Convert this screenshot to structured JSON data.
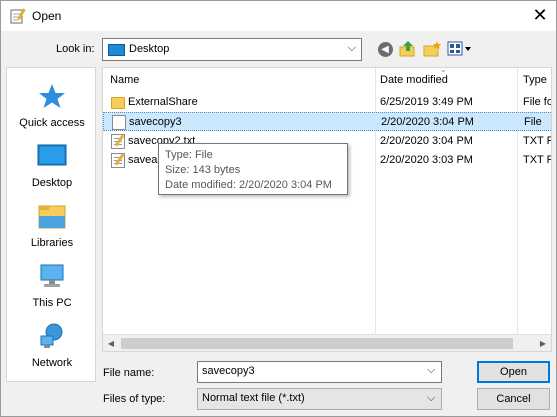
{
  "window": {
    "title": "Open",
    "close_label": "✕"
  },
  "lookin": {
    "label": "Look in:",
    "value": "Desktop"
  },
  "toolbar": {
    "back_glyph": "◀",
    "up_glyph": "⬆",
    "newfolder_glyph": "✱",
    "views_glyph": "▦▾"
  },
  "places": [
    {
      "label": "Quick access",
      "icon": "star-icon"
    },
    {
      "label": "Desktop",
      "icon": "desktop-icon"
    },
    {
      "label": "Libraries",
      "icon": "libraries-icon"
    },
    {
      "label": "This PC",
      "icon": "computer-icon"
    },
    {
      "label": "Network",
      "icon": "network-icon"
    }
  ],
  "columns": {
    "name": "Name",
    "date": "Date modified",
    "type": "Type"
  },
  "files": [
    {
      "name": "ExternalShare",
      "date": "6/25/2019 3:49 PM",
      "type": "File fo",
      "kind": "folder"
    },
    {
      "name": "savecopy3",
      "date": "2/20/2020 3:04 PM",
      "type": "File",
      "kind": "file"
    },
    {
      "name": "savecopy2.txt",
      "date": "2/20/2020 3:04 PM",
      "type": "TXT F",
      "kind": "txt"
    },
    {
      "name": "saveas",
      "date": "2/20/2020 3:03 PM",
      "type": "TXT F",
      "kind": "txt"
    }
  ],
  "tooltip": {
    "type": "Type: File",
    "size": "Size: 143 bytes",
    "modified": "Date modified: 2/20/2020 3:04 PM"
  },
  "filename": {
    "label": "File name:",
    "value": "savecopy3"
  },
  "filetype": {
    "label": "Files of type:",
    "value": "Normal text file (*.txt)"
  },
  "buttons": {
    "open": "Open",
    "cancel": "Cancel"
  },
  "colors": {
    "selection": "#cce8ff",
    "accent": "#0078d7"
  }
}
